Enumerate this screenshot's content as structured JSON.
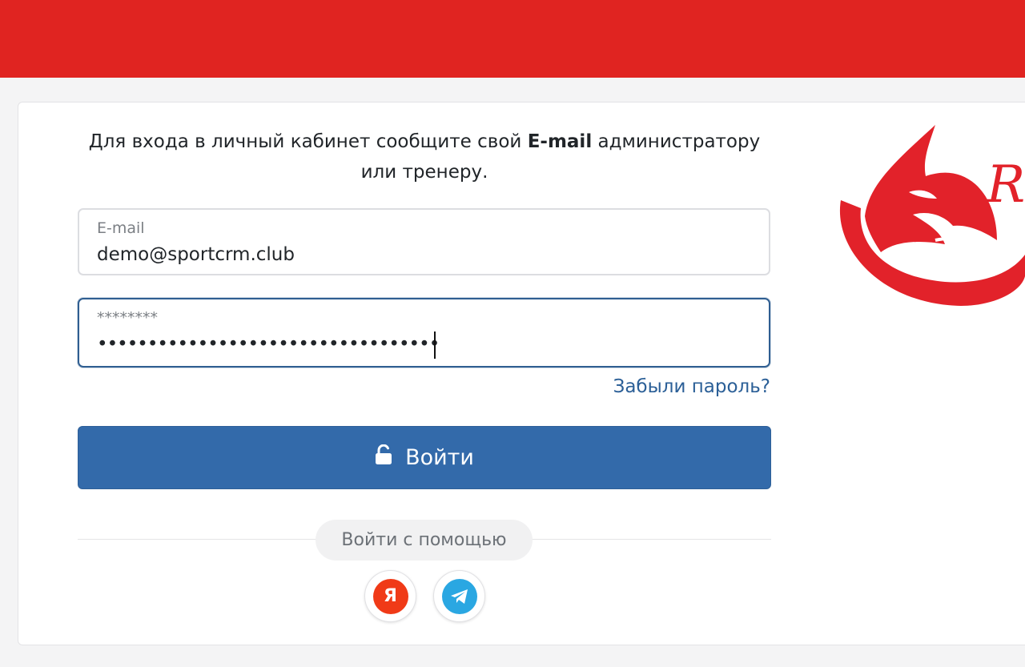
{
  "intro": {
    "text_before": "Для входа в личный кабинет сообщите свой ",
    "bold": "E-mail",
    "text_after": " администратору или тренеру."
  },
  "email_field": {
    "label": "E-mail",
    "value": "demo@sportcrm.club"
  },
  "password_field": {
    "label": "********",
    "masked_value": "••••••••••••••••••••••••••••••••••"
  },
  "forgot_link": "Забыли пароль?",
  "login_button": {
    "label": "Войти",
    "icon": "unlock-icon"
  },
  "social": {
    "label": "Войти с помощью",
    "yandex_glyph": "Я",
    "providers": [
      "yandex-icon",
      "telegram-icon"
    ]
  },
  "logo": {
    "text": "R"
  },
  "colors": {
    "topbar": "#e02421",
    "primary": "#336aaa",
    "link": "#2b5f97",
    "yandex": "#f03a17",
    "telegram": "#2aa7e2"
  }
}
